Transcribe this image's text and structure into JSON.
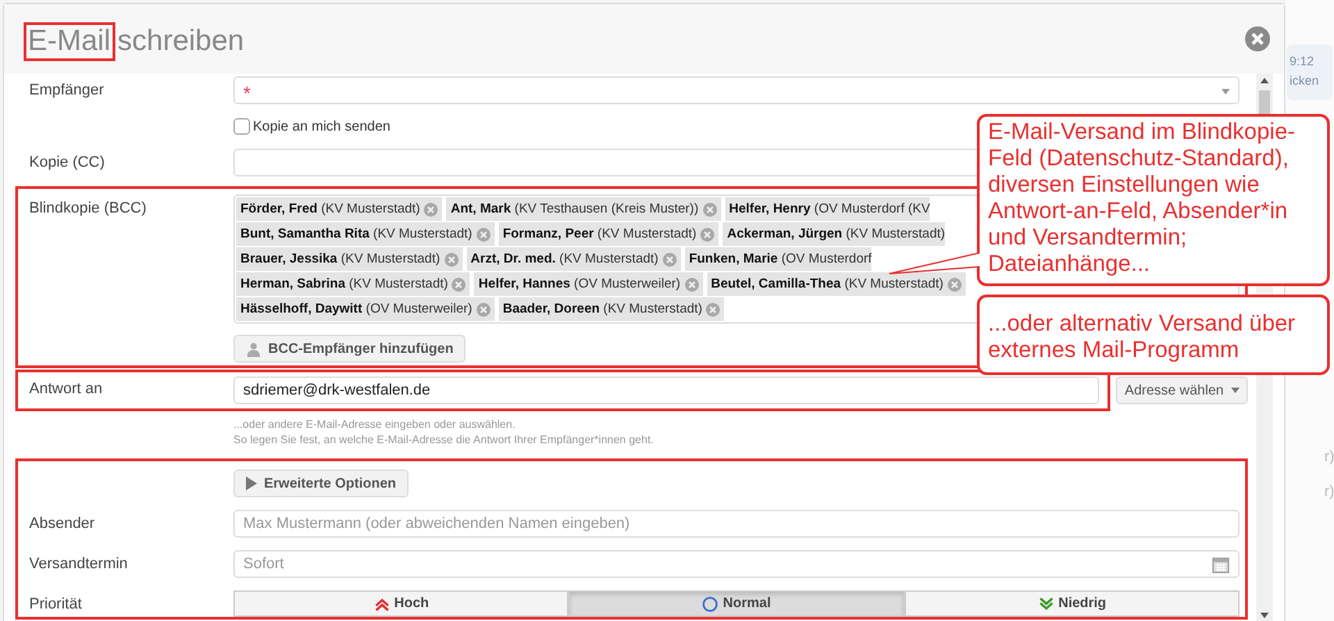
{
  "dialog": {
    "title": [
      {
        "text": "E-Mail",
        "highlighted": true
      },
      {
        "text": "schreiben",
        "highlighted": false
      }
    ]
  },
  "sections": [
    {
      "highlighted": false,
      "fields": [
        {
          "kind": "select",
          "label": "Empfänger",
          "required_mark": "*"
        },
        {
          "kind": "checkbox",
          "label": "Kopie an mich senden",
          "checked": false
        },
        {
          "kind": "text",
          "label": "Kopie (CC)"
        }
      ]
    },
    {
      "highlighted": true,
      "fields": [
        {
          "kind": "tags",
          "label": "Blindkopie (BCC)",
          "button": "BCC-Empfänger hinzufügen",
          "rows": [
            [
              {
                "text": "**Förder, Fred** (KV Musterstadt)",
                "removable": true
              },
              {
                "text": "**Ant, Mark** (KV Testhausen (Kreis Muster))",
                "removable": true
              },
              {
                "text": "**Helfer, Henry** (OV Musterdorf (KV",
                "removable": false
              }
            ],
            [
              {
                "text": "**Bunt, Samantha Rita** (KV Musterstadt)",
                "removable": true
              },
              {
                "text": "**Formanz, Peer** (KV Musterstadt)",
                "removable": true
              },
              {
                "text": "**Ackerman, Jürgen** (KV Musterstadt)",
                "removable": false
              }
            ],
            [
              {
                "text": "**Brauer, Jessika** (KV Musterstadt)",
                "removable": true
              },
              {
                "text": "**Arzt, Dr. med.** (KV Musterstadt)",
                "removable": true
              },
              {
                "text": "**Funken, Marie** (OV Musterdorf",
                "removable": false
              }
            ],
            [
              {
                "text": "**Herman, Sabrina** (KV Musterstadt)",
                "removable": true
              },
              {
                "text": "**Helfer, Hannes** (OV Musterweiler)",
                "removable": true
              },
              {
                "text": "**Beutel, Camilla-Thea** (KV Musterstadt)",
                "removable": true
              }
            ],
            [
              {
                "text": "**Hässelhoff, Daywitt** (OV Musterweiler)",
                "removable": true
              },
              {
                "text": "**Baader, Doreen** (KV Musterstadt)",
                "removable": true
              }
            ]
          ]
        }
      ]
    },
    {
      "highlighted": true,
      "fields": [
        {
          "kind": "text",
          "label": "Antwort an",
          "value": "sdriemer@drk-westfalen.de",
          "button": "Adresse wählen"
        }
      ]
    },
    {
      "highlighted": false,
      "fields": [
        {
          "kind": "hint",
          "lines": [
            "...oder andere E-Mail-Adresse eingeben oder auswählen.",
            "So legen Sie fest, an welche E-Mail-Adresse die Antwort Ihrer Empfänger*innen geht."
          ]
        }
      ]
    },
    {
      "highlighted": true,
      "fields": [
        {
          "kind": "button",
          "button": "Erweiterte Optionen"
        },
        {
          "kind": "text",
          "label": "Absender",
          "placeholder": "Max Mustermann (oder abweichenden Namen eingeben)"
        },
        {
          "kind": "date",
          "label": "Versandtermin",
          "placeholder": "Sofort"
        },
        {
          "kind": "segmented",
          "label": "Priorität",
          "options": [
            {
              "kind": "high",
              "label": "Hoch",
              "selected": false
            },
            {
              "kind": "normal",
              "label": "Normal",
              "selected": true
            },
            {
              "kind": "low",
              "label": "Niedrig",
              "selected": false
            }
          ]
        }
      ]
    }
  ],
  "annotations": [
    {
      "text": "E-Mail-Versand im Blindkopie-Feld (Datenschutz-Standard), diversen Einstellungen wie Antwort-an-Feld, Absender*in und Versandtermin; Dateianhänge...",
      "leader": true
    },
    {
      "text": "...oder alternativ Versand über externes Mail-Programm"
    }
  ],
  "background": {
    "badge_lines": [
      "9:12",
      "icken"
    ],
    "row_texts": [
      "r)",
      "r)"
    ]
  }
}
